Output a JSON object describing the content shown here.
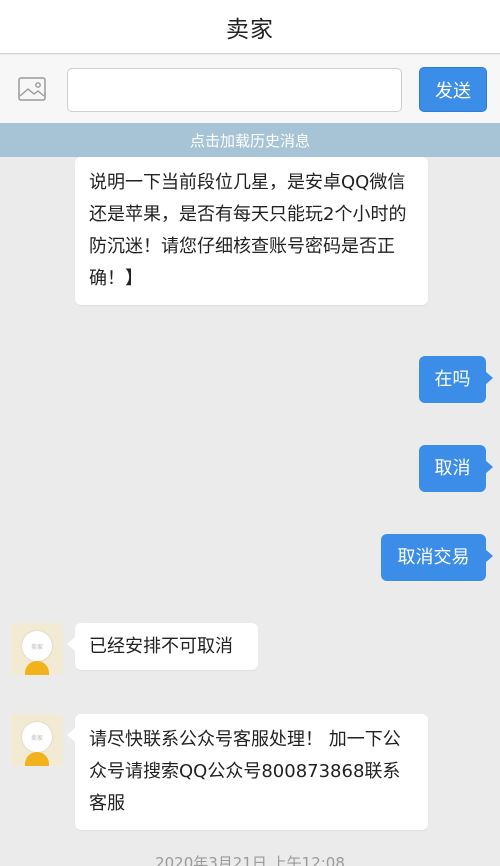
{
  "header": {
    "title": "卖家"
  },
  "input_bar": {
    "image_icon": "image-icon",
    "input_value": "",
    "input_placeholder": "",
    "send_label": "发送"
  },
  "history": {
    "label": "点击加载历史消息"
  },
  "messages": [
    {
      "side": "left",
      "text": "说明一下当前段位几星，是安卓QQ微信还是苹果，是否有每天只能玩2个小时的防沉迷！请您仔细核查账号密码是否正确！】"
    },
    {
      "side": "right",
      "text": "在吗"
    },
    {
      "side": "right",
      "text": "取消"
    },
    {
      "side": "right",
      "text": "取消交易"
    },
    {
      "side": "left",
      "avatar_label": "卖家",
      "text": "已经安排不可取消"
    },
    {
      "side": "left",
      "avatar_label": "卖家",
      "text": "请尽快联系公众号客服处理！ 加一下公众号请搜索QQ公众号800873868联系客服"
    }
  ],
  "timestamp": "2020年3月21日 上午12:08",
  "colors": {
    "accent": "#3b8de8",
    "history_bar": "#a7c4d6",
    "background": "#ebebeb"
  }
}
